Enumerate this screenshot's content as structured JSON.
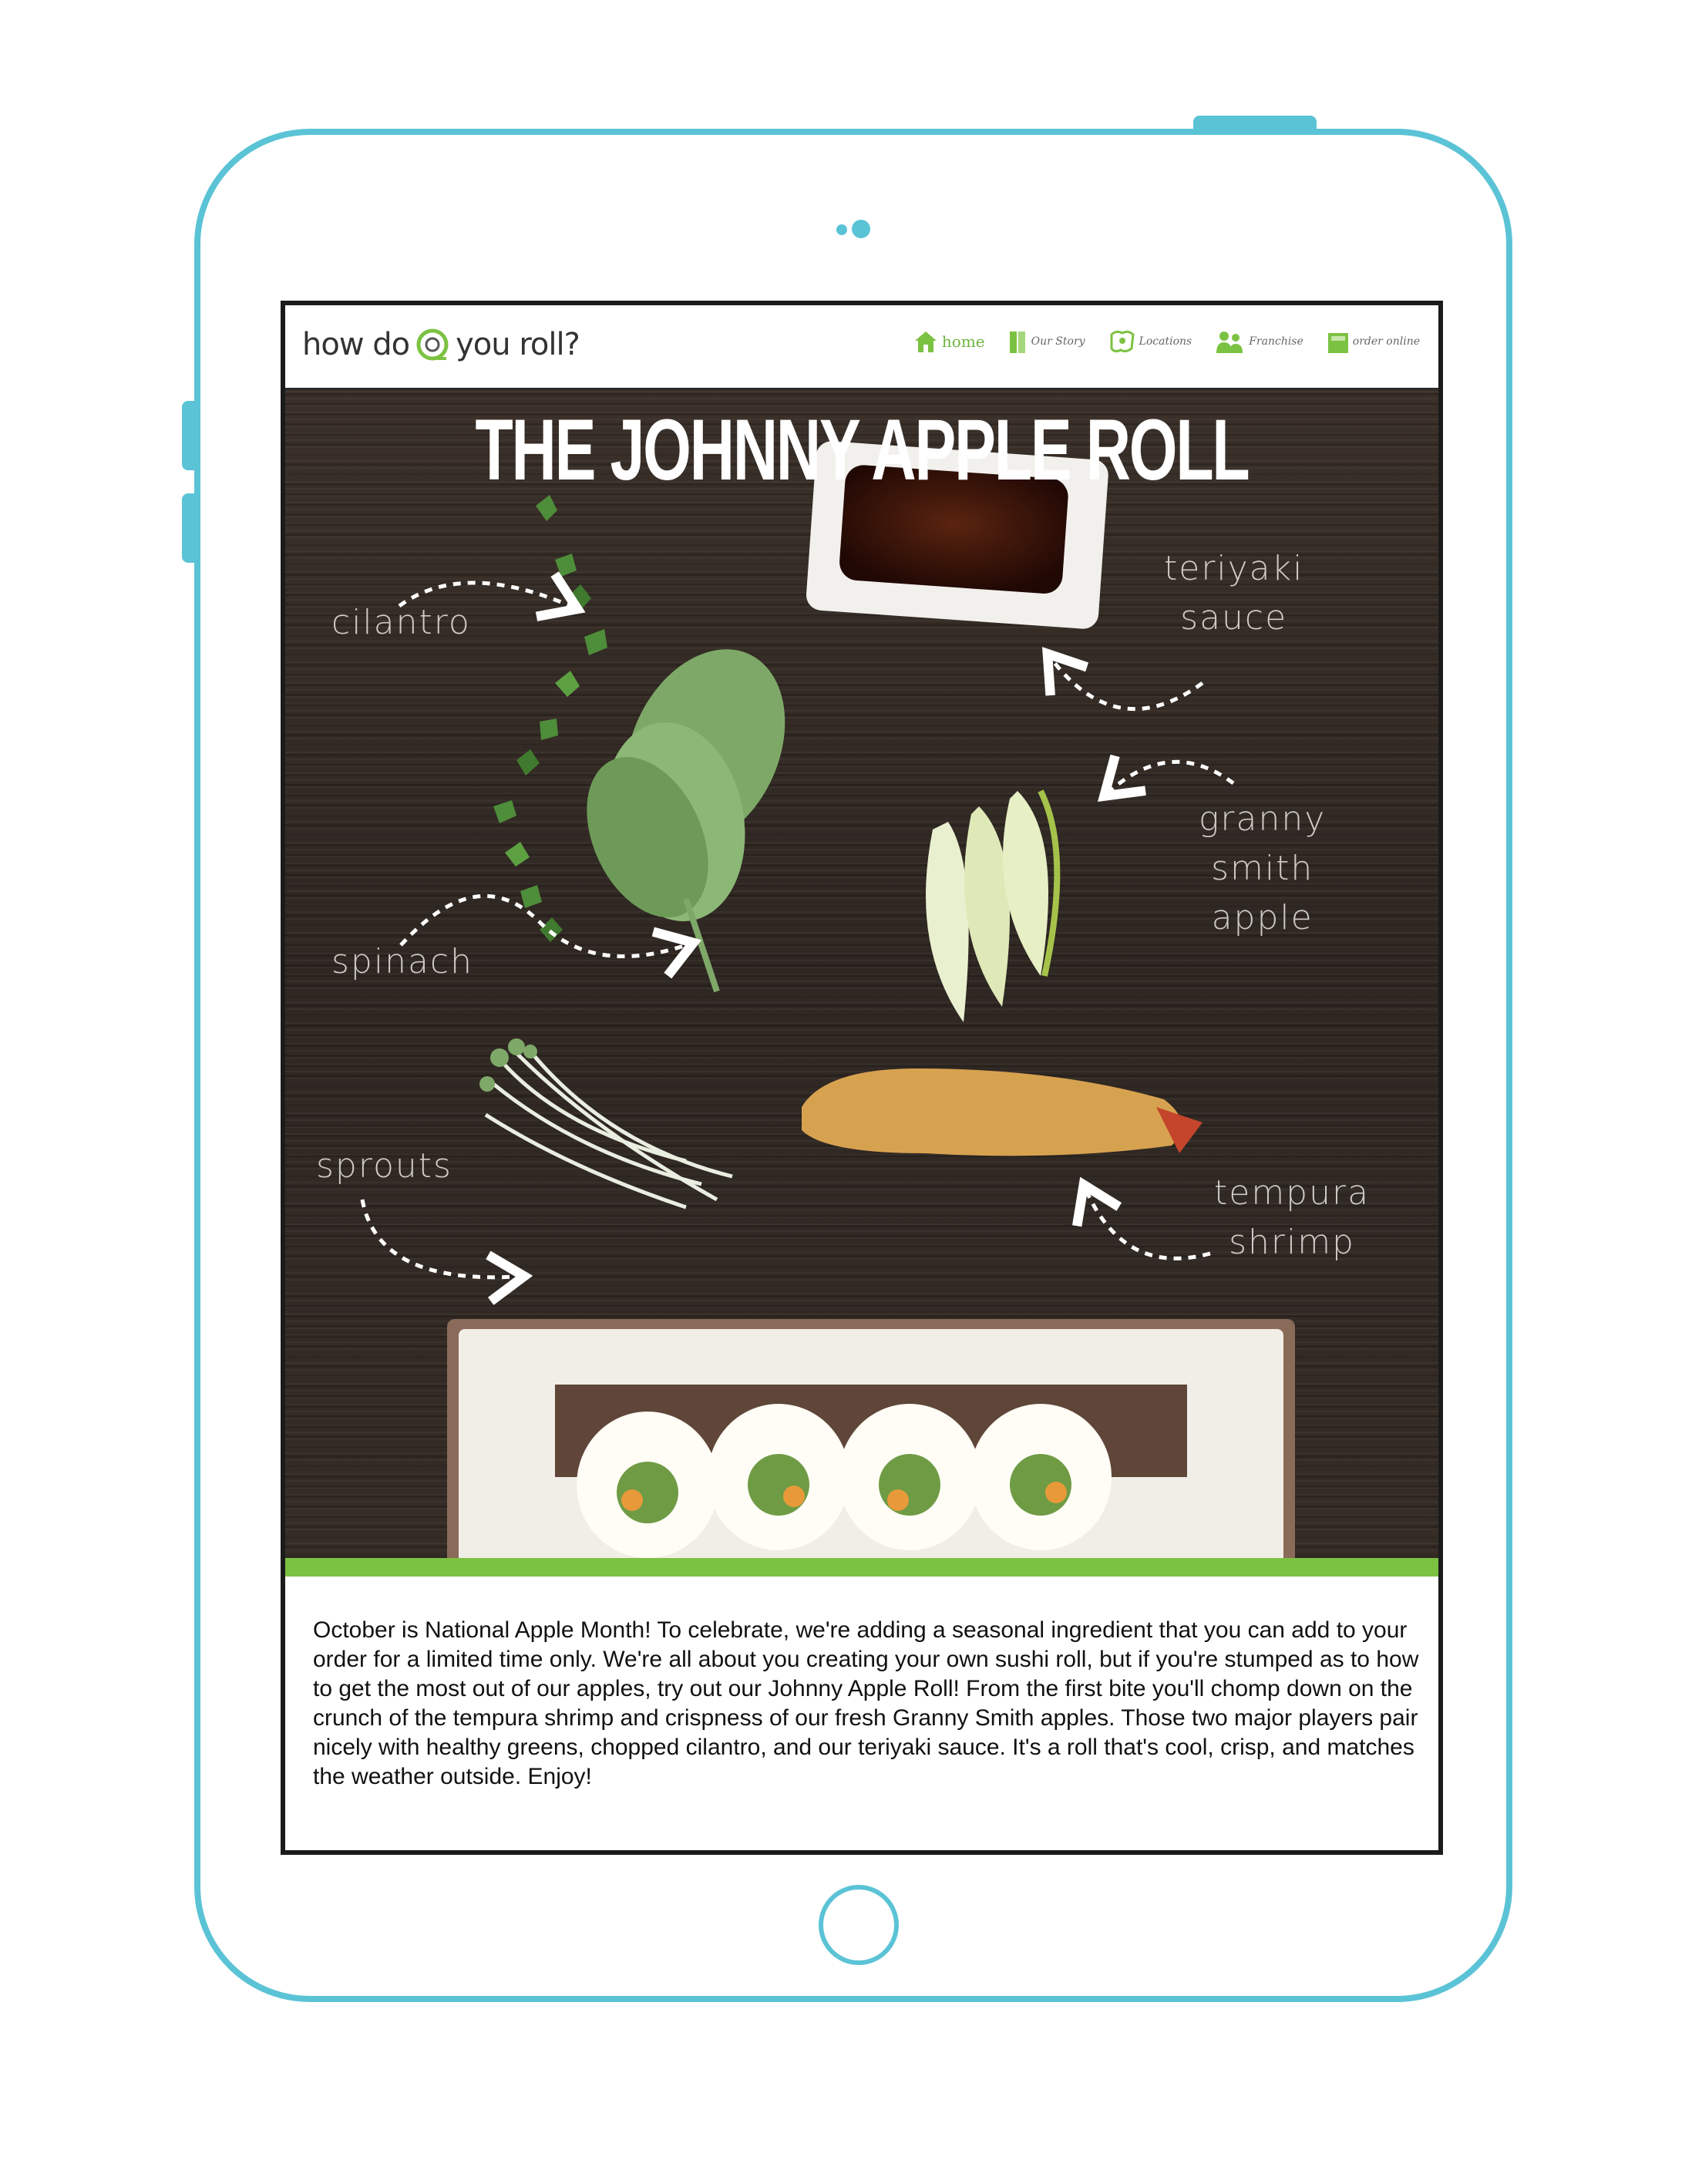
{
  "header": {
    "logo_left": "how do",
    "logo_right": "you roll?",
    "nav": [
      {
        "label": "home",
        "icon": "house-icon"
      },
      {
        "label": "Our Story",
        "icon": "book-icon"
      },
      {
        "label": "Locations",
        "icon": "map-icon"
      },
      {
        "label": "Franchise",
        "icon": "people-icon"
      },
      {
        "label": "order online",
        "icon": "order-icon"
      }
    ]
  },
  "hero": {
    "title": "THE JOHNNY APPLE ROLL",
    "ingredients": {
      "cilantro": "cilantro",
      "teriyaki": "teriyaki sauce",
      "teriyaki_line1": "teriyaki",
      "teriyaki_line2": "sauce",
      "apple_line1": "granny",
      "apple_line2": "smith",
      "apple_line3": "apple",
      "spinach": "spinach",
      "sprouts": "sprouts",
      "shrimp_line1": "tempura",
      "shrimp_line2": "shrimp"
    }
  },
  "article": {
    "body": " October is National Apple Month! To celebrate, we're adding a seasonal ingredient that you can add to your order for a limited time only. We're all about you creating your own sushi roll, but if you're stumped as to how to get the most out of our apples, try out our Johnny Apple Roll! From the first bite you'll chomp down on the crunch of the tempura shrimp and crispness of our fresh Granny Smith apples. Those two major players pair nicely with healthy greens, chopped cilantro, and our teriyaki sauce. It's a roll that's cool, crisp, and matches the weather outside. Enjoy!"
  },
  "colors": {
    "frame": "#5bc3d6",
    "brand_green": "#7cc242",
    "wood": "#2f2722"
  }
}
